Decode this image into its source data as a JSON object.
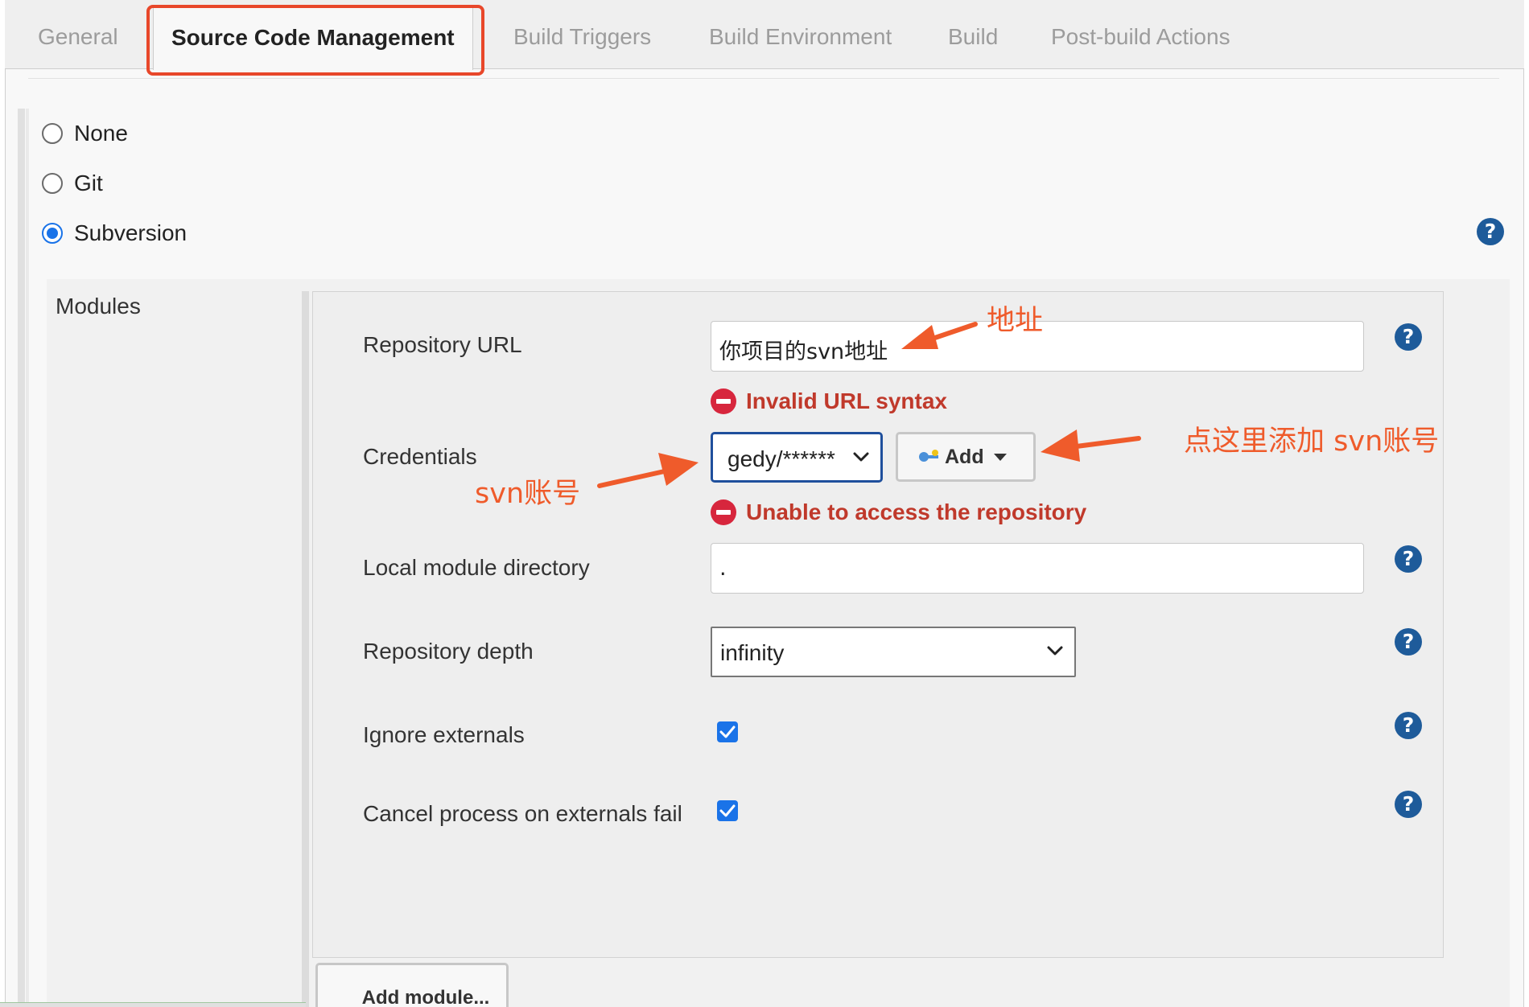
{
  "tabs": [
    {
      "label": "General",
      "active": false
    },
    {
      "label": "Source Code Management",
      "active": true
    },
    {
      "label": "Build Triggers",
      "active": false
    },
    {
      "label": "Build Environment",
      "active": false
    },
    {
      "label": "Build",
      "active": false
    },
    {
      "label": "Post-build Actions",
      "active": false
    }
  ],
  "scm": {
    "options": [
      {
        "label": "None",
        "selected": false
      },
      {
        "label": "Git",
        "selected": false
      },
      {
        "label": "Subversion",
        "selected": true
      }
    ]
  },
  "modules": {
    "label": "Modules",
    "repository_url": {
      "label": "Repository URL",
      "value": "你项目的svn地址",
      "error": "Invalid URL syntax"
    },
    "credentials": {
      "label": "Credentials",
      "value": "gedy/******",
      "add_label": "Add",
      "error": "Unable to access the repository"
    },
    "local_module_directory": {
      "label": "Local module directory",
      "value": "."
    },
    "repository_depth": {
      "label": "Repository depth",
      "value": "infinity"
    },
    "ignore_externals": {
      "label": "Ignore externals",
      "checked": true
    },
    "cancel_process": {
      "label": "Cancel process on externals fail",
      "checked": true
    },
    "add_module_label": "Add module..."
  },
  "annotations": {
    "address": "地址",
    "svn_account": "svn账号",
    "click_add": "点这里添加 svn账号"
  },
  "colors": {
    "annotation": "#ef5b2b",
    "help_icon": "#1e5b9a",
    "error": "#c0392b",
    "accent": "#1a73e8"
  },
  "icons": {
    "help": "question-circle-icon",
    "error": "minus-circle-icon",
    "credential": "key-icon",
    "dropdown": "chevron-down-icon"
  }
}
